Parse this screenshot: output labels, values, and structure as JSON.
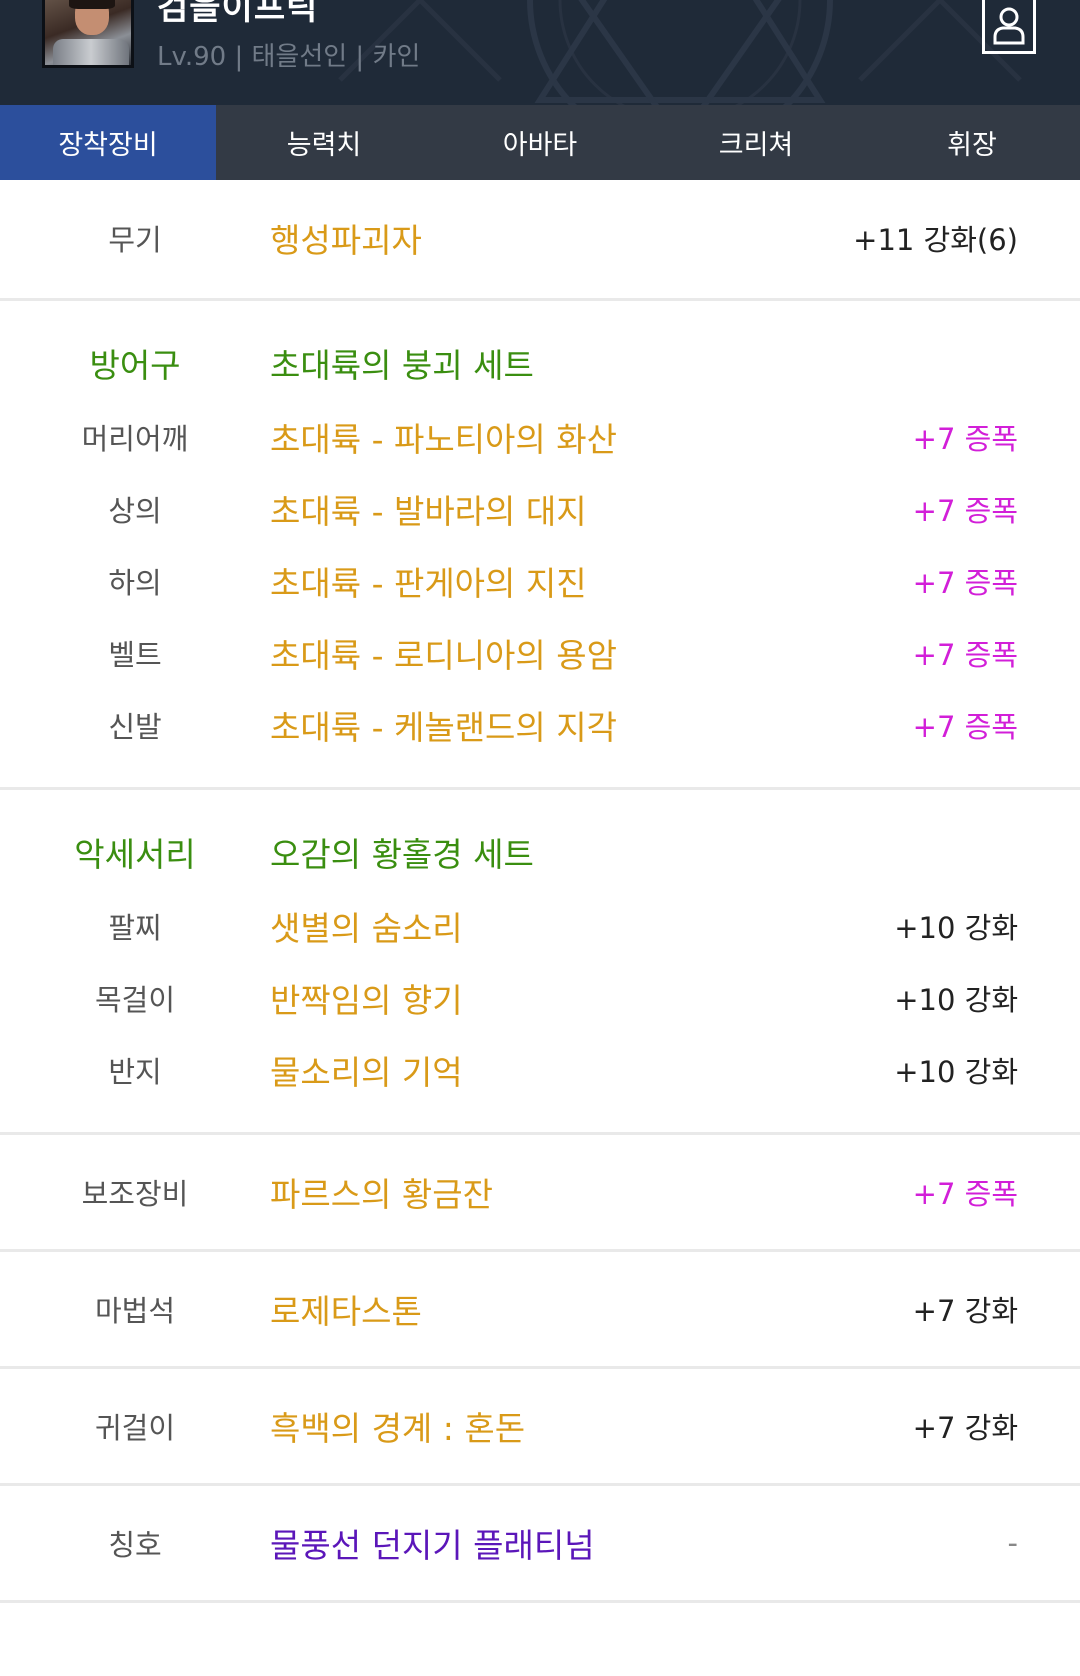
{
  "header": {
    "character_name": "검을이프릭",
    "info": "Lv.90 | 태을선인 | 카인"
  },
  "tabs": [
    {
      "label": "장착장비",
      "active": true
    },
    {
      "label": "능력치",
      "active": false
    },
    {
      "label": "아바타",
      "active": false
    },
    {
      "label": "크리쳐",
      "active": false
    },
    {
      "label": "휘장",
      "active": false
    }
  ],
  "weapon": {
    "label": "무기",
    "name": "행성파괴자",
    "upgrade": "+11 강화(6)"
  },
  "armor": {
    "group_label": "방어구",
    "set_name": "초대륙의 붕괴 세트",
    "items": [
      {
        "label": "머리어깨",
        "name": "초대륙 - 파노티아의 화산",
        "upgrade": "+7 증폭"
      },
      {
        "label": "상의",
        "name": "초대륙 - 발바라의 대지",
        "upgrade": "+7 증폭"
      },
      {
        "label": "하의",
        "name": "초대륙 - 판게아의 지진",
        "upgrade": "+7 증폭"
      },
      {
        "label": "벨트",
        "name": "초대륙 - 로디니아의 용암",
        "upgrade": "+7 증폭"
      },
      {
        "label": "신발",
        "name": "초대륙 - 케놀랜드의 지각",
        "upgrade": "+7 증폭"
      }
    ]
  },
  "accessory": {
    "group_label": "악세서리",
    "set_name": "오감의 황홀경 세트",
    "items": [
      {
        "label": "팔찌",
        "name": "샛별의 숨소리",
        "upgrade": "+10 강화"
      },
      {
        "label": "목걸이",
        "name": "반짝임의 향기",
        "upgrade": "+10 강화"
      },
      {
        "label": "반지",
        "name": "물소리의 기억",
        "upgrade": "+10 강화"
      }
    ]
  },
  "sub_equipment": {
    "label": "보조장비",
    "name": "파르스의 황금잔",
    "upgrade": "+7 증폭"
  },
  "magic_stone": {
    "label": "마법석",
    "name": "로제타스톤",
    "upgrade": "+7 강화"
  },
  "earring": {
    "label": "귀걸이",
    "name": "흑백의 경계 : 혼돈",
    "upgrade": "+7 강화"
  },
  "title": {
    "label": "칭호",
    "name": "물풍선 던지기 플래티넘",
    "upgrade": "-"
  },
  "colors": {
    "header_bg": "#1f2a38",
    "tab_bar": "#333a45",
    "tab_active": "#2c4f9c",
    "item_gold": "#d99a18",
    "set_green": "#3a8e10",
    "amplify_magenta": "#d21fd8",
    "title_purple": "#5b16b9"
  }
}
